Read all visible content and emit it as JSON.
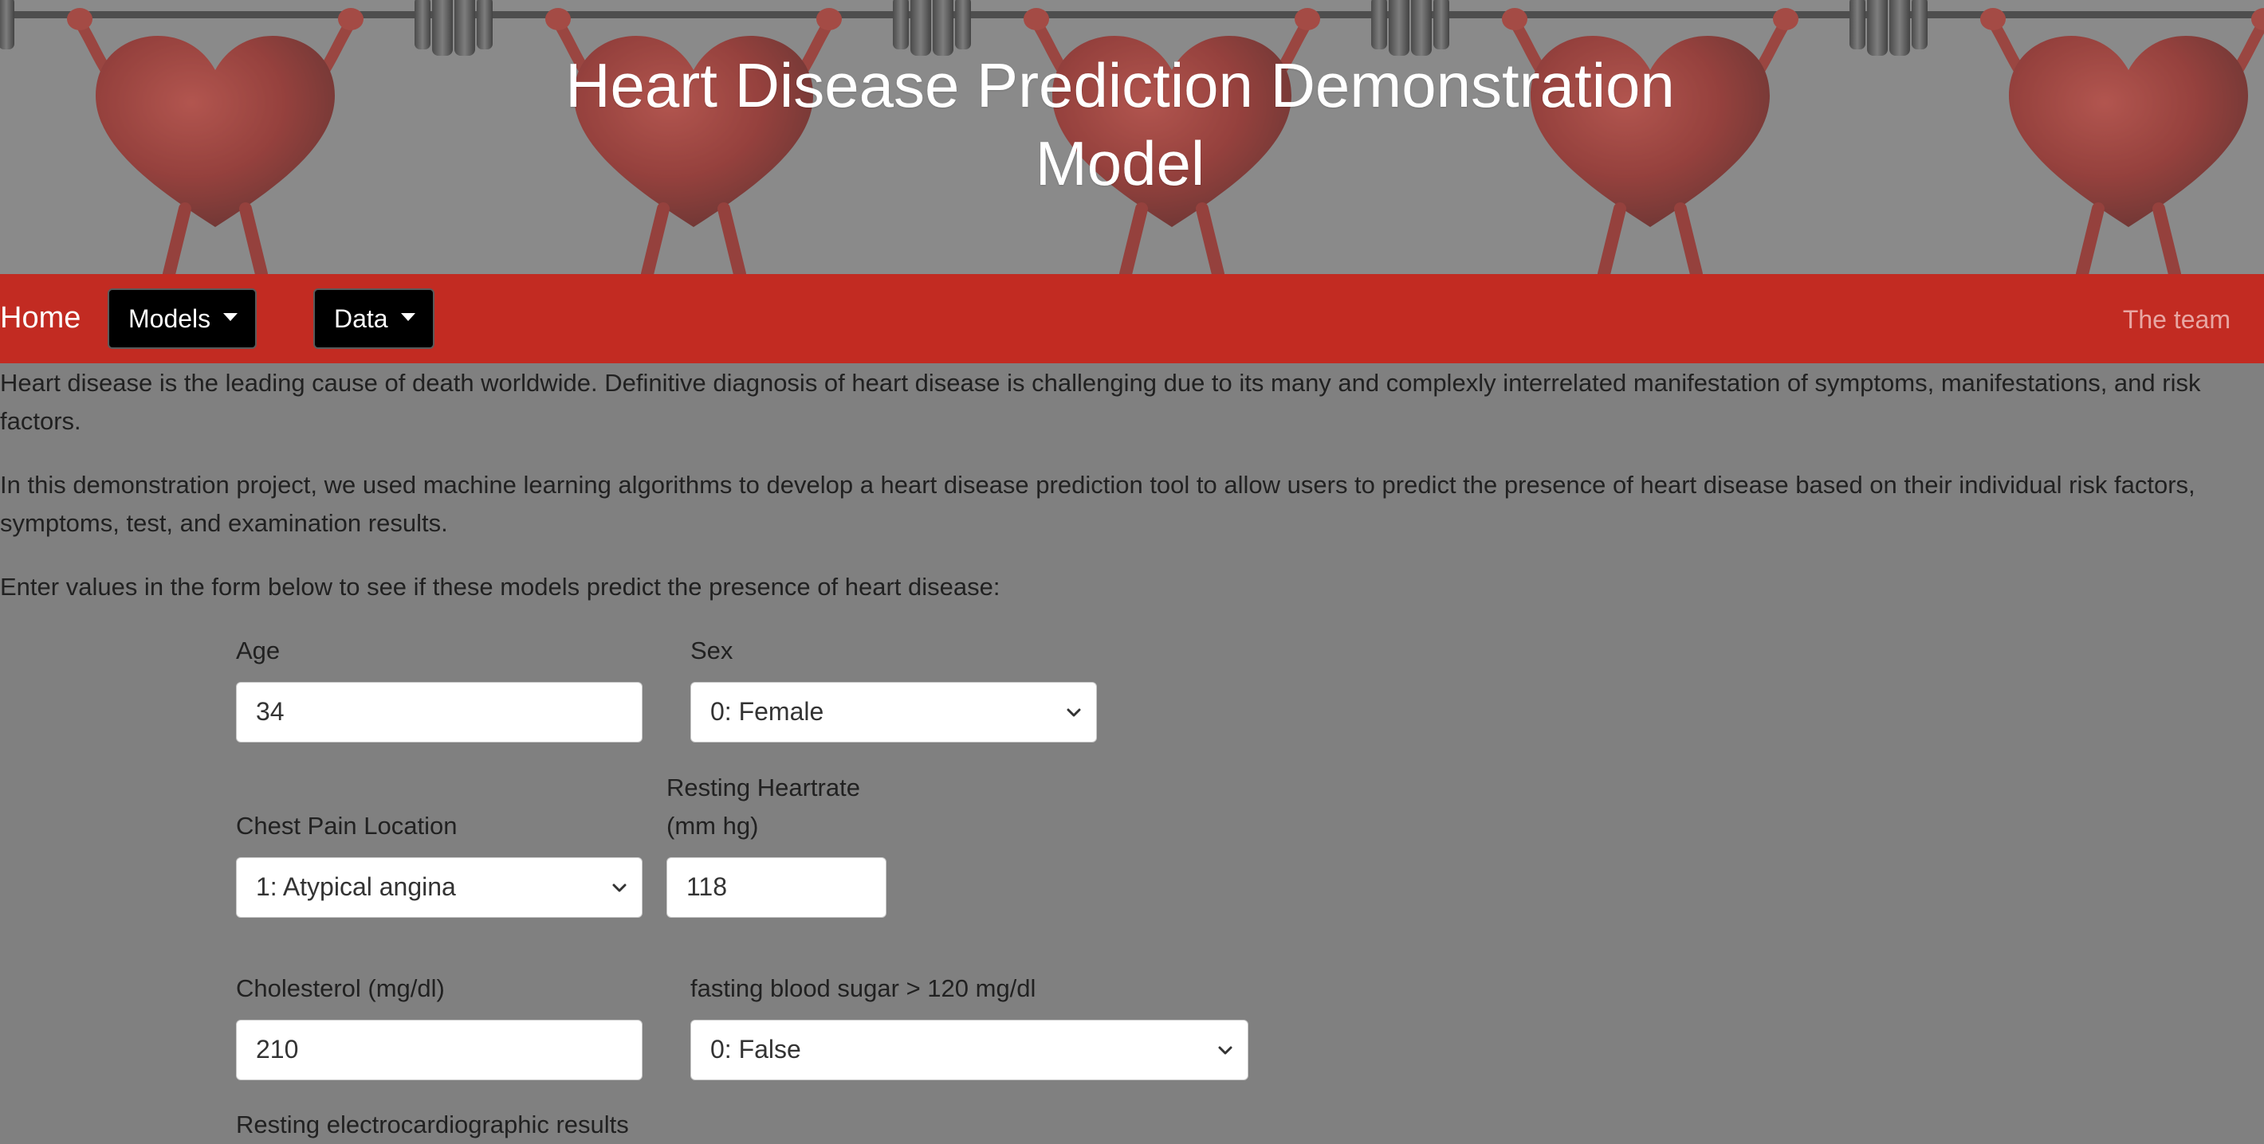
{
  "header": {
    "title_line1": "Heart Disease Prediction Demonstration",
    "title_line2": "Model"
  },
  "nav": {
    "home": "Home",
    "models": "Models",
    "data": "Data",
    "team": "The team"
  },
  "intro": {
    "p1": "Heart disease is the leading cause of death worldwide. Definitive diagnosis of heart disease is challenging due to its many and complexly interrelated manifestation of symptoms, manifestations, and risk factors.",
    "p2": "In this demonstration project, we used machine learning algorithms to develop a heart disease prediction tool to allow users to predict the presence of heart disease based on their individual risk factors, symptoms, test, and examination results.",
    "p3": "Enter values in the form below to see if these models predict the presence of heart disease:"
  },
  "form": {
    "age": {
      "label": "Age",
      "value": "34"
    },
    "sex": {
      "label": "Sex",
      "value": "0: Female"
    },
    "chest_pain": {
      "label": "Chest Pain Location",
      "value": "1: Atypical angina"
    },
    "resting_hr": {
      "label_line1": "Resting Heartrate",
      "label_line2": "(mm hg)",
      "value": "118"
    },
    "cholesterol": {
      "label": "Cholesterol (mg/dl)",
      "value": "210"
    },
    "fbs": {
      "label": "fasting blood sugar > 120 mg/dl",
      "value": "0: False"
    },
    "ecg": {
      "label": "Resting electrocardiographic results"
    }
  },
  "colors": {
    "navbar": "#c22b22",
    "page_background": "#808080",
    "dropdown_button": "#000000",
    "team_link": "#e8a6a2"
  },
  "icons": {
    "banner": "heart-lifting-barbell-pattern",
    "dropdown": "caret-down-icon",
    "select": "chevron-down-icon"
  }
}
